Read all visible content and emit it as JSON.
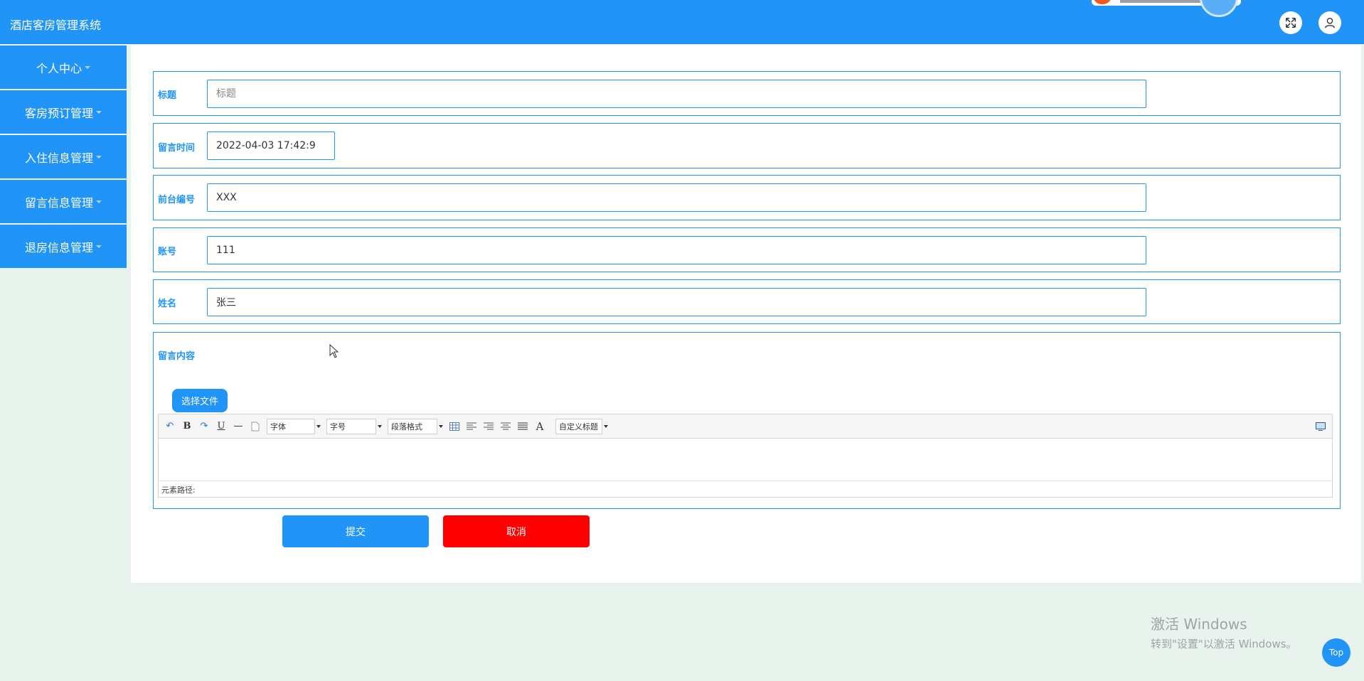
{
  "header": {
    "title": "酒店客房管理系统",
    "fullscreen_icon": "expand-arrows-icon",
    "user_icon": "user-icon"
  },
  "sidebar": {
    "items": [
      {
        "label": "个人中心"
      },
      {
        "label": "客房预订管理"
      },
      {
        "label": "入住信息管理"
      },
      {
        "label": "留言信息管理"
      },
      {
        "label": "退房信息管理"
      }
    ]
  },
  "form": {
    "title": {
      "label": "标题",
      "value": "",
      "placeholder": "标题"
    },
    "time": {
      "label": "留言时间",
      "value": "2022-04-03 17:42:9"
    },
    "desk_no": {
      "label": "前台编号",
      "value": "XXX"
    },
    "account": {
      "label": "账号",
      "value": "111"
    },
    "name": {
      "label": "姓名",
      "value": "张三"
    },
    "content": {
      "label": "留言内容",
      "upload_label": "选择文件",
      "toolbar": {
        "undo": "↶",
        "bold": "B",
        "redo": "↷",
        "underline": "U",
        "hr": "—",
        "font_family": "字体",
        "font_size": "字号",
        "paragraph": "段落格式",
        "font_color": "A",
        "custom_title": "自定义标题"
      },
      "status_path": "元素路径:"
    },
    "submit_label": "提交",
    "cancel_label": "取消"
  },
  "watermark": {
    "line1": "激活 Windows",
    "line2": "转到\"设置\"以激活 Windows。"
  },
  "back_to_top": "Top",
  "colors": {
    "primary": "#2194f7",
    "danger": "#ff0000",
    "page_bg": "#e8f3ee"
  }
}
